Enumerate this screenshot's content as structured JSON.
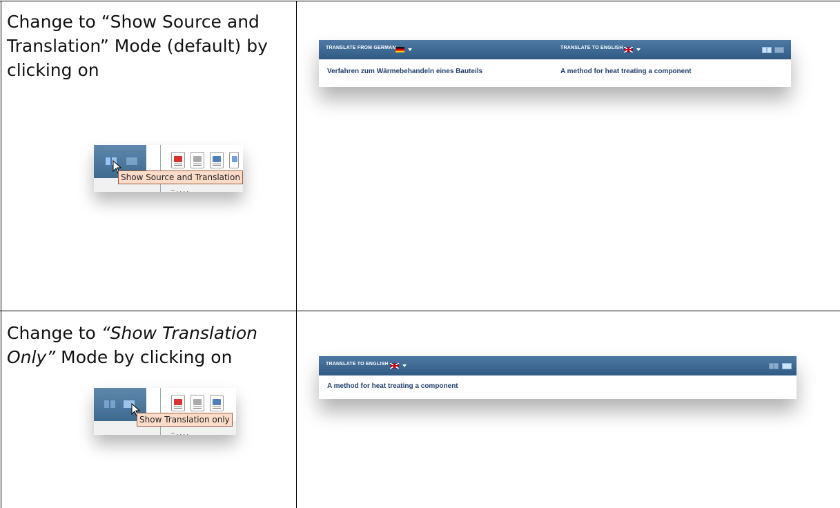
{
  "row1": {
    "instruction_line1": "Change to “Show Source and",
    "instruction_line2": "Translation” Mode (default) by",
    "instruction_line3": "clicking on",
    "tooltip": "Show Source and Translation",
    "panel": {
      "source_label": "TRANSLATE FROM GERMAN",
      "target_label": "TRANSLATE TO ENGLISH",
      "source_text": "Verfahren zum Wärmebehandeln eines Bauteils",
      "target_text": "A method for heat treating a component"
    }
  },
  "row2": {
    "instruction_part1": "Change to ",
    "instruction_italic1": "“Show Translation",
    "instruction_italic2": "Only”",
    "instruction_part2": " Mode by clicking on",
    "tooltip": "Show Translation only",
    "panel": {
      "target_label": "TRANSLATE TO ENGLISH",
      "target_text": "A method for heat treating a component"
    }
  },
  "colors": {
    "toolbar_top": "#4f7aa3",
    "toolbar_bottom": "#2e5a84",
    "link_text": "#1f3f6e",
    "tooltip_bg": "#fcdcc8"
  },
  "icons": [
    "split-view-icon",
    "single-view-icon",
    "pdf-icon",
    "document-icon",
    "print-icon",
    "mouse-cursor-icon",
    "german-flag-icon",
    "uk-flag-icon",
    "dropdown-caret-icon"
  ]
}
